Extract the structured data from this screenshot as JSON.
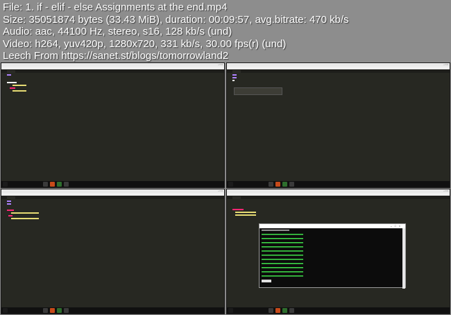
{
  "info": {
    "line1": "File: 1. if - elif - else  Assignments at the end.mp4",
    "line2": "Size: 35051874 bytes (33.43 MiB), duration: 00:09:57, avg.bitrate: 470 kb/s",
    "line3": "Audio: aac, 44100 Hz, stereo, s16, 128 kb/s (und)",
    "line4": "Video: h264, yuv420p, 1280x720, 331 kb/s, 30.00 fps(r) (und)",
    "line5": "Leech From https://sanet.st/blogs/tomorrowland2"
  },
  "colors": {
    "editor_bg": "#272822",
    "keyword": "#f92672",
    "string": "#e6db74",
    "cmd_green": "#3fe24a"
  }
}
